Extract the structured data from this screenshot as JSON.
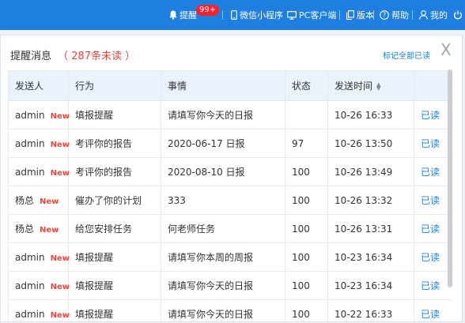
{
  "topbar": {
    "remind_label": "提醒",
    "remind_badge": "99+",
    "mini_program_label": "微信小程序",
    "pc_client_label": "PC客户端",
    "version_label": "版本",
    "help_label": "帮助",
    "mine_label": "我的"
  },
  "panel": {
    "title": "提醒消息",
    "unread_count": "（ 287条未读 ）",
    "mark_all_label": "标记全部已读",
    "close_label": "X"
  },
  "table": {
    "headers": {
      "sender": "发送人",
      "action": "行为",
      "subject": "事情",
      "status": "状态",
      "time": "发送时间"
    },
    "rows": [
      {
        "sender": "admin",
        "badge": "New",
        "action": "填报提醒",
        "subject": "请填写你今天的日报",
        "status": "",
        "time": "10-26 16:33",
        "op": "已读"
      },
      {
        "sender": "admin",
        "badge": "New",
        "action": "考评你的报告",
        "subject": "2020-06-17 日报",
        "status": "97",
        "time": "10-26 13:50",
        "op": "已读"
      },
      {
        "sender": "admin",
        "badge": "New",
        "action": "考评你的报告",
        "subject": "2020-08-10 日报",
        "status": "100",
        "time": "10-26 13:49",
        "op": "已读"
      },
      {
        "sender": "杨总",
        "badge": "New",
        "action": "催办了你的计划",
        "subject": "333",
        "status": "100",
        "time": "10-26 13:32",
        "op": "已读"
      },
      {
        "sender": "杨总",
        "badge": "New",
        "action": "给您安排任务",
        "subject": "何老师任务",
        "status": "100",
        "time": "10-26 13:31",
        "op": "已读"
      },
      {
        "sender": "admin",
        "badge": "New",
        "action": "填报提醒",
        "subject": "请填写你本周的周报",
        "status": "100",
        "time": "10-23 16:34",
        "op": "已读"
      },
      {
        "sender": "admin",
        "badge": "New",
        "action": "填报提醒",
        "subject": "请填写你今天的日报",
        "status": "100",
        "time": "10-23 16:34",
        "op": "已读"
      },
      {
        "sender": "admin",
        "badge": "New",
        "action": "填报提醒",
        "subject": "请填写你今天的日报",
        "status": "100",
        "time": "10-22 16:33",
        "op": "已读"
      }
    ]
  },
  "icons": {
    "bell": "bell-icon",
    "phone": "phone-icon",
    "monitor": "monitor-icon",
    "copy": "copy-icon",
    "help": "help-icon",
    "user": "user-icon",
    "power": "power-icon"
  },
  "colors": {
    "topbar_bg": "#1e7fe0",
    "badge_bg": "#f5222d",
    "unread_red": "#e8483e",
    "link_blue": "#1e7fe0",
    "header_bg": "#eaf2fb"
  }
}
